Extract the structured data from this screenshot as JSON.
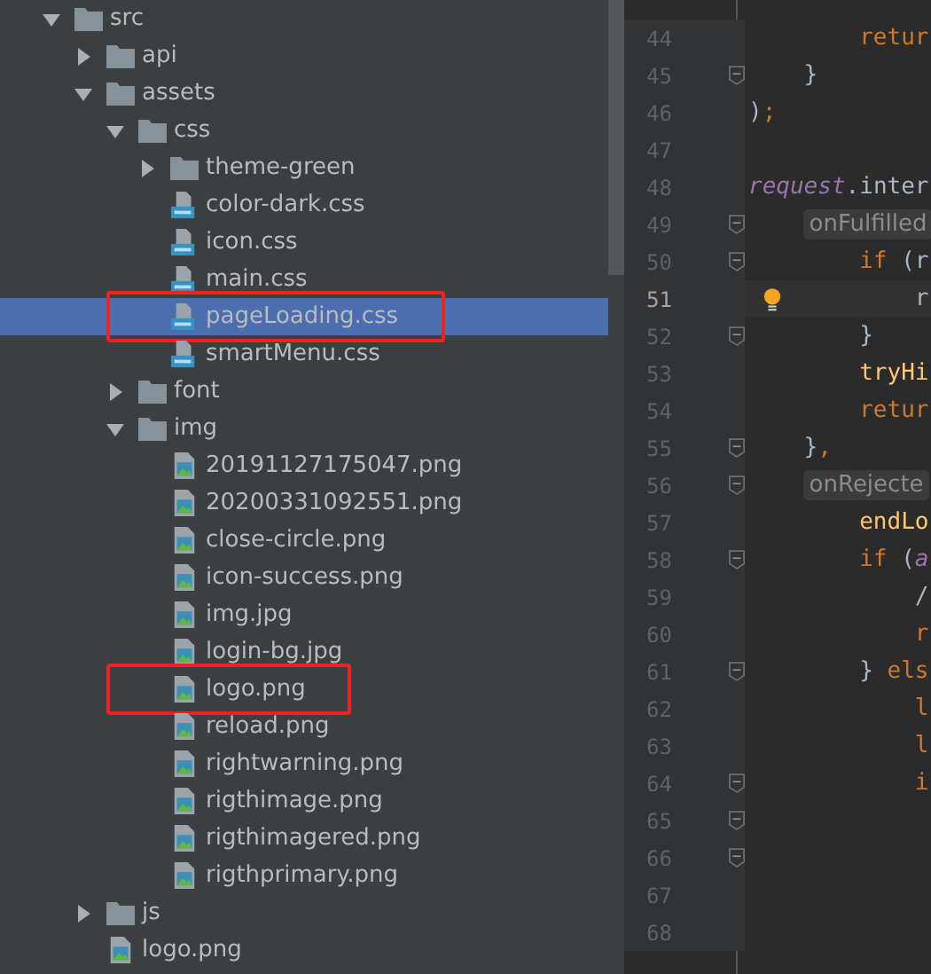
{
  "tree": [
    {
      "name": "src",
      "kind": "folder",
      "expanded": true,
      "selected": false,
      "children": [
        {
          "name": "api",
          "kind": "folder",
          "expanded": false,
          "selected": false
        },
        {
          "name": "assets",
          "kind": "folder",
          "expanded": true,
          "selected": false,
          "children": [
            {
              "name": "css",
              "kind": "folder",
              "expanded": true,
              "selected": false,
              "children": [
                {
                  "name": "theme-green",
                  "kind": "folder",
                  "expanded": false,
                  "selected": false
                },
                {
                  "name": "color-dark.css",
                  "kind": "css",
                  "selected": false
                },
                {
                  "name": "icon.css",
                  "kind": "css",
                  "selected": false
                },
                {
                  "name": "main.css",
                  "kind": "css",
                  "selected": false
                },
                {
                  "name": "pageLoading.css",
                  "kind": "css",
                  "selected": true,
                  "annotated": true
                },
                {
                  "name": "smartMenu.css",
                  "kind": "css",
                  "selected": false
                }
              ]
            },
            {
              "name": "font",
              "kind": "folder",
              "expanded": false,
              "selected": false
            },
            {
              "name": "img",
              "kind": "folder",
              "expanded": true,
              "selected": false,
              "children": [
                {
                  "name": "20191127175047.png",
                  "kind": "image",
                  "selected": false
                },
                {
                  "name": "20200331092551.png",
                  "kind": "image",
                  "selected": false
                },
                {
                  "name": "close-circle.png",
                  "kind": "image",
                  "selected": false
                },
                {
                  "name": "icon-success.png",
                  "kind": "image",
                  "selected": false
                },
                {
                  "name": "img.jpg",
                  "kind": "image",
                  "selected": false
                },
                {
                  "name": "login-bg.jpg",
                  "kind": "image",
                  "selected": false
                },
                {
                  "name": "logo.png",
                  "kind": "image",
                  "selected": false,
                  "annotated": true
                },
                {
                  "name": "reload.png",
                  "kind": "image",
                  "selected": false
                },
                {
                  "name": "rightwarning.png",
                  "kind": "image",
                  "selected": false
                },
                {
                  "name": "rigthimage.png",
                  "kind": "image",
                  "selected": false
                },
                {
                  "name": "rigthimagered.png",
                  "kind": "image",
                  "selected": false
                },
                {
                  "name": "rigthprimary.png",
                  "kind": "image",
                  "selected": false
                }
              ]
            }
          ]
        },
        {
          "name": "js",
          "kind": "folder",
          "expanded": false,
          "selected": false
        },
        {
          "name": "logo.png",
          "kind": "image",
          "selected": false
        }
      ]
    }
  ],
  "editor": {
    "lines": [
      {
        "number": "44",
        "fold": false,
        "tokens": [
          {
            "kind": "keyword",
            "text": "        retur"
          }
        ]
      },
      {
        "number": "45",
        "fold": true,
        "tokens": [
          {
            "kind": "brace",
            "text": "    }"
          }
        ]
      },
      {
        "number": "46",
        "fold": false,
        "tokens": [
          {
            "kind": "brace",
            "text": ")"
          },
          {
            "kind": "keyword",
            "text": ";"
          }
        ]
      },
      {
        "number": "47",
        "fold": false
      },
      {
        "number": "48",
        "fold": false,
        "tokens": [
          {
            "kind": "var",
            "text": "request"
          },
          {
            "kind": "plain",
            "text": ".inter"
          }
        ]
      },
      {
        "number": "49",
        "fold": true,
        "tokens": [
          {
            "kind": "hint",
            "text": "    onFulfilled"
          }
        ]
      },
      {
        "number": "50",
        "fold": true,
        "tokens": [
          {
            "kind": "keyword",
            "text": "        if "
          },
          {
            "kind": "brace",
            "text": "("
          },
          {
            "kind": "plain",
            "text": "r"
          }
        ]
      },
      {
        "number": "51",
        "fold": false,
        "current": true,
        "bulb": true,
        "tokens": [
          {
            "kind": "plain",
            "text": "            r"
          }
        ]
      },
      {
        "number": "52",
        "fold": true,
        "tokens": [
          {
            "kind": "brace",
            "text": "        }"
          }
        ]
      },
      {
        "number": "53",
        "fold": false,
        "tokens": [
          {
            "kind": "func",
            "text": "        tryHi"
          }
        ]
      },
      {
        "number": "54",
        "fold": false,
        "tokens": [
          {
            "kind": "keyword",
            "text": "        retur"
          }
        ]
      },
      {
        "number": "55",
        "fold": true,
        "tokens": [
          {
            "kind": "brace",
            "text": "    }"
          },
          {
            "kind": "keyword",
            "text": ","
          }
        ]
      },
      {
        "number": "56",
        "fold": true,
        "tokens": [
          {
            "kind": "hint",
            "text": "    onRejecte"
          }
        ]
      },
      {
        "number": "57",
        "fold": false,
        "tokens": [
          {
            "kind": "func",
            "text": "        endLo"
          }
        ]
      },
      {
        "number": "58",
        "fold": true,
        "tokens": [
          {
            "kind": "keyword",
            "text": "        if "
          },
          {
            "kind": "brace",
            "text": "("
          },
          {
            "kind": "var",
            "text": "a"
          }
        ]
      },
      {
        "number": "59",
        "fold": false,
        "tokens": [
          {
            "kind": "plain",
            "text": "            /"
          }
        ]
      },
      {
        "number": "60",
        "fold": false,
        "tokens": [
          {
            "kind": "keyword",
            "text": "            r"
          }
        ]
      },
      {
        "number": "61",
        "fold": true,
        "tokens": [
          {
            "kind": "brace",
            "text": "        } "
          },
          {
            "kind": "keyword",
            "text": "els"
          }
        ]
      },
      {
        "number": "62",
        "fold": false,
        "tokens": [
          {
            "kind": "keyword",
            "text": "            l"
          }
        ]
      },
      {
        "number": "63",
        "fold": false,
        "tokens": [
          {
            "kind": "keyword",
            "text": "            l"
          }
        ]
      },
      {
        "number": "64",
        "fold": true,
        "tokens": [
          {
            "kind": "keyword",
            "text": "            i"
          }
        ]
      },
      {
        "number": "65",
        "fold": true
      },
      {
        "number": "66",
        "fold": true
      },
      {
        "number": "67",
        "fold": false
      },
      {
        "number": "68",
        "fold": false
      }
    ]
  }
}
